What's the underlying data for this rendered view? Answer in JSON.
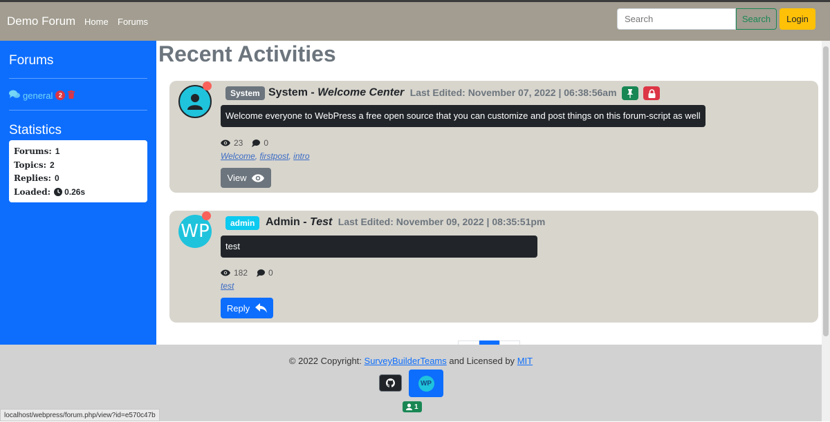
{
  "nav": {
    "brand": "Demo Forum",
    "links": [
      "Home",
      "Forums"
    ],
    "search_placeholder": "Search",
    "search_button": "Search",
    "login_button": "Login"
  },
  "sidebar": {
    "forums_heading": "Forums",
    "forums": [
      {
        "name": "general",
        "count": "2"
      }
    ],
    "statistics_heading": "Statistics",
    "stats": [
      {
        "label": "Forums:",
        "value": "1"
      },
      {
        "label": "Topics:",
        "value": "2"
      },
      {
        "label": "Replies:",
        "value": "0"
      },
      {
        "label": "Loaded:",
        "value": "0.26s"
      }
    ]
  },
  "main": {
    "title": "Recent Activities",
    "posts": [
      {
        "role": "System",
        "author": "System",
        "separator": "-",
        "topic": "Welcome Center",
        "edited": "Last Edited: November 07, 2022 | 06:38:56am",
        "body": "Welcome everyone to WebPress a free open source that you can customize and post things on this forum-script as well",
        "views": "23",
        "comments": "0",
        "tags": [
          "Welcome",
          "firstpost",
          "intro"
        ],
        "action": "View"
      },
      {
        "role": "admin",
        "author": "Admin",
        "separator": "-",
        "topic": "Test",
        "edited": "Last Edited: November 09, 2022 | 08:35:51pm",
        "body": "test",
        "views": "182",
        "comments": "0",
        "tags": [
          "test"
        ],
        "action": "Reply",
        "avatar_text": "WP"
      }
    ]
  },
  "footer": {
    "copyright_prefix": "© 2022 Copyright:",
    "team_link": "SurveyBuilderTeams",
    "licensed_text": "and Licensed by",
    "license_link": "MIT",
    "wp_logo_text": "WP",
    "users_online": "1"
  },
  "status_bar_url": "localhost/webpress/forum.php/view?id=e570c47b",
  "colors": {
    "navbar": "#a29d90",
    "sidebar": "#0d6efd",
    "card": "#d8d5cd",
    "login": "#ffc107",
    "danger": "#dc3545",
    "success": "#198754",
    "info": "#0dcaf0"
  }
}
